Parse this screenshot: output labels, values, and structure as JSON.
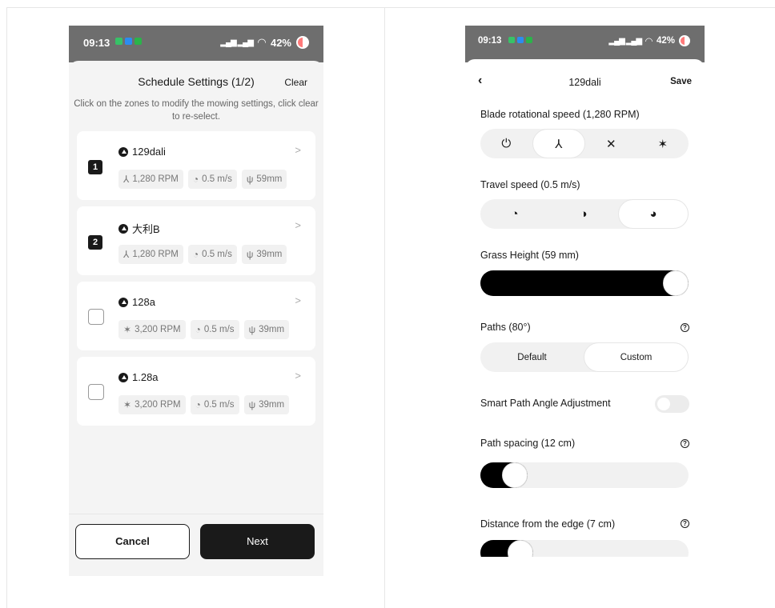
{
  "left": {
    "status": {
      "time": "09:13",
      "battery": "42%"
    },
    "title": "Schedule Settings (1/2)",
    "clear_label": "Clear",
    "description": "Click on the zones to modify the mowing settings, click clear to re-select.",
    "zones": [
      {
        "marker": "1",
        "selected": true,
        "name": "129dali",
        "rpm": "1,280 RPM",
        "speed": "0.5 m/s",
        "height": "59mm"
      },
      {
        "marker": "2",
        "selected": true,
        "name": "大利B",
        "rpm": "1,280 RPM",
        "speed": "0.5 m/s",
        "height": "39mm"
      },
      {
        "marker": "",
        "selected": false,
        "name": "128a",
        "rpm": "3,200 RPM",
        "speed": "0.5 m/s",
        "height": "39mm"
      },
      {
        "marker": "",
        "selected": false,
        "name": "1.28a",
        "rpm": "3,200 RPM",
        "speed": "0.5 m/s",
        "height": "39mm"
      }
    ],
    "cancel_label": "Cancel",
    "next_label": "Next"
  },
  "right": {
    "status": {
      "time": "09:13",
      "battery": "42%"
    },
    "back_glyph": "‹",
    "title": "129dali",
    "save_label": "Save",
    "blade_label": "Blade rotational speed (1,280 RPM)",
    "blade_options": [
      "power-icon",
      "blade-3-icon",
      "blade-4-icon",
      "blade-5-icon"
    ],
    "blade_selected_index": 1,
    "travel_label": "Travel speed (0.5 m/s)",
    "travel_options": [
      "speed-1-icon",
      "speed-2-icon",
      "speed-3-icon"
    ],
    "travel_selected_index": 2,
    "grass_label": "Grass Height (59 mm)",
    "grass_level": 1.0,
    "paths_label": "Paths (80°)",
    "paths_default": "Default",
    "paths_custom": "Custom",
    "paths_selected": "Custom",
    "smart_label": "Smart Path Angle Adjustment",
    "smart_on": false,
    "spacing_label": "Path spacing (12 cm)",
    "spacing_level": 0.12,
    "edge_label": "Distance from the edge (7 cm)",
    "edge_level": 0.15,
    "help_glyph": "?"
  }
}
